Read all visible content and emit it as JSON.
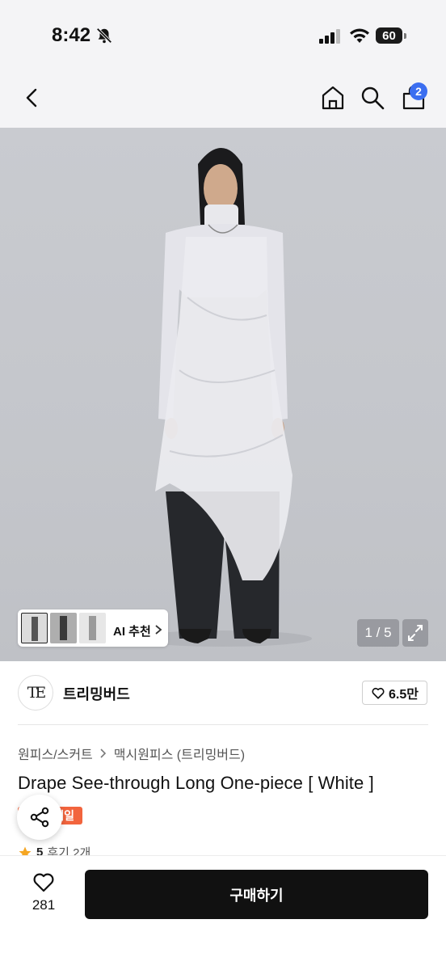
{
  "status_bar": {
    "time": "8:42",
    "battery": "60",
    "icons": [
      "bell-off-icon",
      "signal-icon",
      "wifi-icon",
      "battery-icon"
    ]
  },
  "nav": {
    "icons": [
      "back-icon",
      "home-icon",
      "search-icon",
      "shopping-bag-icon"
    ],
    "cart_badge": "2"
  },
  "gallery": {
    "ai_recommend_label": "AI 추천",
    "page_indicator": "1 / 5",
    "thumbnail_count": 3
  },
  "brand": {
    "logo_text": "TE",
    "name": "트리밍버드",
    "likes": "6.5만"
  },
  "product": {
    "breadcrumb": [
      "원피스/스커트",
      "맥시원피스 (트리밍버드)"
    ],
    "title": "Drape See-through Long One-piece [ White ]",
    "sale_badge": "세일",
    "rating_score": "5",
    "review_count": "후기 2개"
  },
  "bottom_bar": {
    "wish_count": "281",
    "buy_label": "구매하기"
  },
  "colors": {
    "accent_blue": "#3b6ef0",
    "sale_orange": "#f2643d",
    "buy_button": "#111111",
    "star": "#f5a623"
  }
}
